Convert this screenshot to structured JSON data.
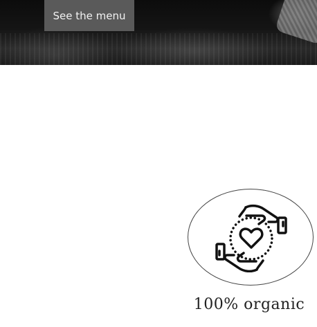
{
  "hero": {
    "menu_button_label": "See the menu"
  },
  "feature": {
    "icon": "hands-heart-icon",
    "label": "100% organic"
  }
}
